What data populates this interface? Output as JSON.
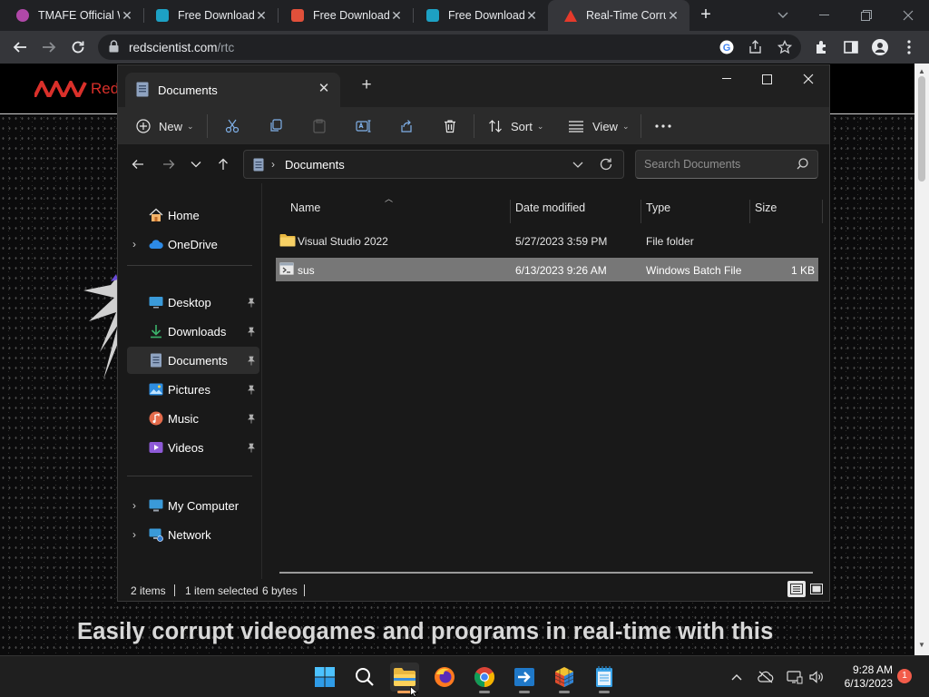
{
  "browser": {
    "tabs": [
      {
        "title": "TMAFE Official W",
        "favicon_color": "#b048a8"
      },
      {
        "title": "Free Download",
        "favicon_color": "#1da1c4"
      },
      {
        "title": "Free Download",
        "favicon_color": "#e0503a"
      },
      {
        "title": "Free Download",
        "favicon_color": "#1da1c4"
      },
      {
        "title": "Real-Time Corru",
        "favicon_color": "#e53a2b"
      }
    ],
    "url_host": "redscientist.com",
    "url_path": "/rtc"
  },
  "site": {
    "brand": "Red",
    "tagline": "Easily corrupt videogames and programs in real-time with this"
  },
  "explorer": {
    "tab_title": "Documents",
    "toolbar": {
      "new_label": "New",
      "sort_label": "Sort",
      "view_label": "View"
    },
    "breadcrumb": "Documents",
    "search_placeholder": "Search Documents",
    "sidebar": {
      "home": "Home",
      "onedrive": "OneDrive",
      "desktop": "Desktop",
      "downloads": "Downloads",
      "documents": "Documents",
      "pictures": "Pictures",
      "music": "Music",
      "videos": "Videos",
      "my_computer": "My Computer",
      "network": "Network"
    },
    "columns": {
      "name": "Name",
      "date": "Date modified",
      "type": "Type",
      "size": "Size"
    },
    "files": [
      {
        "name": "Visual Studio 2022",
        "date": "5/27/2023 3:59 PM",
        "type": "File folder",
        "size": ""
      },
      {
        "name": "sus",
        "date": "6/13/2023 9:26 AM",
        "type": "Windows Batch File",
        "size": "1 KB"
      }
    ],
    "status": {
      "items": "2 items",
      "selected": "1 item selected",
      "size": "6 bytes"
    }
  },
  "taskbar": {
    "time": "9:28 AM",
    "date": "6/13/2023",
    "notifications": "1"
  }
}
